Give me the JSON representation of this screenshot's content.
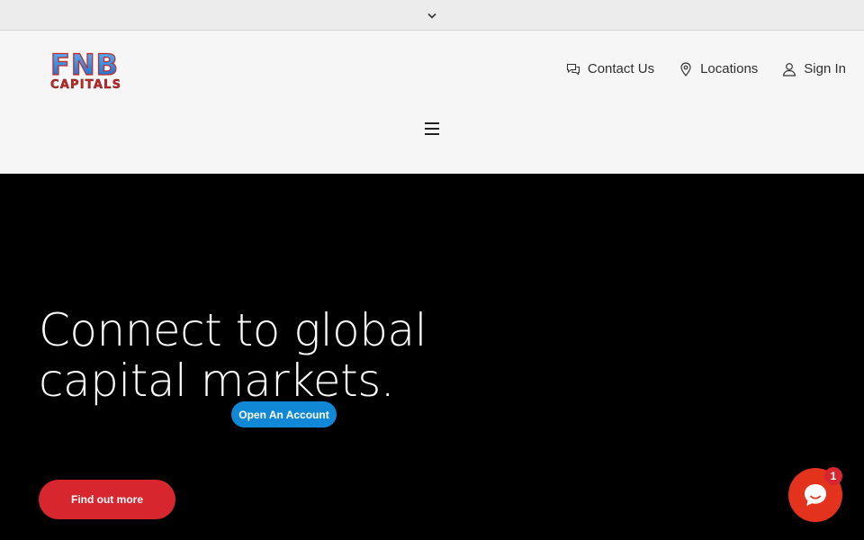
{
  "topbar": {
    "toggle_icon": "chevron-down-icon"
  },
  "header": {
    "logo": {
      "line1": "FNB",
      "line2": "CAPITALS"
    },
    "nav": [
      {
        "label": "Contact Us",
        "icon": "chat-bubbles-icon"
      },
      {
        "label": "Locations",
        "icon": "map-pin-icon"
      },
      {
        "label": "Sign In",
        "icon": "user-icon"
      }
    ],
    "menu_icon": "hamburger-menu-icon"
  },
  "hero": {
    "headline": "Connect to global capital markets.",
    "open_account_label": "Open An Account",
    "find_out_more_label": "Find out more"
  },
  "chat_widget": {
    "badge_count": "1"
  },
  "colors": {
    "brand_red": "#d7262e",
    "brand_blue": "#1188d6",
    "chat_orange": "#e3331c",
    "header_bg": "#f6f6f6",
    "hero_bg": "#000000"
  }
}
